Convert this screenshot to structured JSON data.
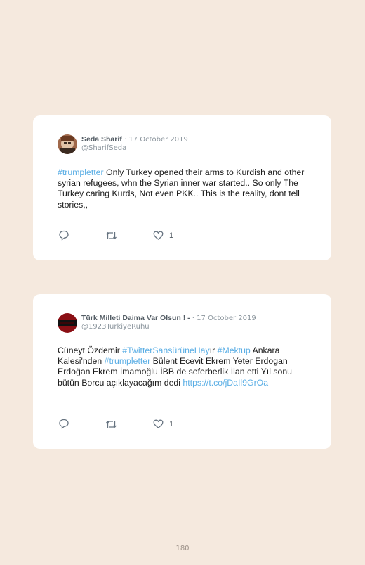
{
  "tweets": [
    {
      "name": "Seda Sharif",
      "date": " · 17 October 2019",
      "handle": "@SharifSeda",
      "text_parts": [
        {
          "link": "#trumpletter"
        },
        {
          "text": " Only Turkey opened their arms to Kurdish and other syrian refugees, whn the Syrian inner war started.. So only The Turkey caring Kurds, Not even PKK.. This is the reality, dont tell stories,,"
        }
      ],
      "likes": "1"
    },
    {
      "name": "Türk Milleti Daima Var Olsun ! -",
      "date": " · 17 October 2019",
      "handle": "@1923TurkiyeRuhu",
      "text_parts": [
        {
          "text": "Cüneyt Özdemir "
        },
        {
          "link": "#TwitterSansürüneHay"
        },
        {
          "text": "ır "
        },
        {
          "link": "#Mektup"
        },
        {
          "text": " Ankara Kalesi'nden "
        },
        {
          "link": "#trumpletter"
        },
        {
          "text": " Bülent Ecevit Ekrem Yeter Erdogan Erdoğan Ekrem İmamoğlu İBB de seferberlik İlan etti Yıl sonu bütün Borcu açıklayacağım dedi "
        },
        {
          "link": "https://t.co/jDaIl9GrOa"
        }
      ],
      "likes": "1"
    }
  ],
  "page_number": "180",
  "colors": {
    "background": "#f5e9de",
    "link": "#5aaee5"
  },
  "icons": [
    "reply-icon",
    "retweet-icon",
    "heart-icon"
  ]
}
